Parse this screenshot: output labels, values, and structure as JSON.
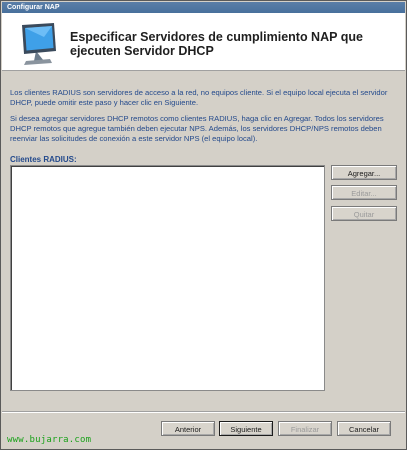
{
  "window": {
    "title": "Configurar NAP"
  },
  "header": {
    "icon": "network-monitor-icon",
    "title": "Especificar Servidores de cumplimiento NAP que ejecuten Servidor DHCP"
  },
  "instructions": {
    "para1": "Los clientes RADIUS son servidores de acceso a la red, no equipos cliente. Si el equipo local ejecuta el servidor DHCP, puede omitir este paso y hacer clic en Siguiente.",
    "para2": "Si desea agregar servidores DHCP remotos como clientes RADIUS, haga clic en Agregar. Todos los servidores DHCP remotos que agregue también deben ejecutar NPS. Además, los servidores DHCP/NPS remotos deben reenviar las solicitudes de conexión a este servidor NPS (el equipo local)."
  },
  "radius_clients": {
    "label": "Clientes RADIUS:",
    "items": []
  },
  "side_buttons": {
    "add": "Agregar...",
    "edit": "Editar...",
    "remove": "Quitar"
  },
  "footer_buttons": {
    "back": "Anterior",
    "next": "Siguiente",
    "finish": "Finalizar",
    "cancel": "Cancelar"
  },
  "watermark": "www.bujarra.com"
}
